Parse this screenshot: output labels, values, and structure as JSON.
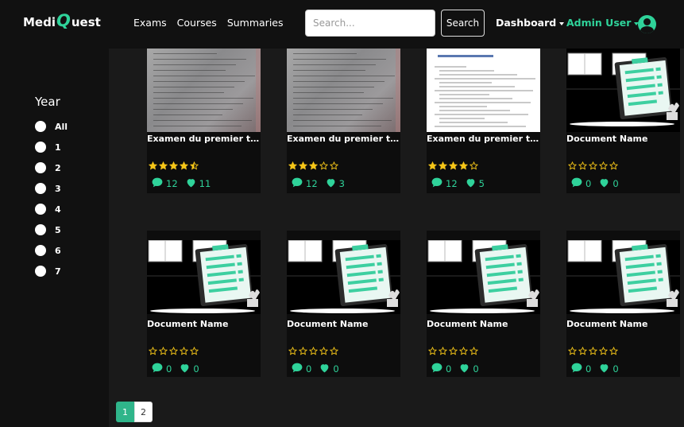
{
  "brand": {
    "part1": "Medi",
    "q": "Q",
    "part2": "uest"
  },
  "nav": {
    "exams": "Exams",
    "courses": "Courses",
    "summaries": "Summaries"
  },
  "search": {
    "placeholder": "Search...",
    "button": "Search"
  },
  "user_menu": {
    "dashboard": "Dashboard",
    "admin": "Admin User"
  },
  "colors": {
    "accent": "#2fd39a",
    "star": "#f5c518"
  },
  "filter": {
    "title": "Year",
    "options": [
      "All",
      "1",
      "2",
      "3",
      "4",
      "5",
      "6",
      "7"
    ]
  },
  "cards": [
    {
      "title": "Examen du premier tri...",
      "rating": 4.5,
      "comments": "12",
      "likes": "11",
      "thumb": "photo"
    },
    {
      "title": "Examen du premier tri...",
      "rating": 3,
      "comments": "12",
      "likes": "3",
      "thumb": "photo"
    },
    {
      "title": "Examen du premier tri...",
      "rating": 4,
      "comments": "12",
      "likes": "5",
      "thumb": "paper"
    },
    {
      "title": "Document Name",
      "rating": 0,
      "comments": "0",
      "likes": "0",
      "thumb": "illustration"
    },
    {
      "title": "Document Name",
      "rating": 0,
      "comments": "0",
      "likes": "0",
      "thumb": "illustration"
    },
    {
      "title": "Document Name",
      "rating": 0,
      "comments": "0",
      "likes": "0",
      "thumb": "illustration"
    },
    {
      "title": "Document Name",
      "rating": 0,
      "comments": "0",
      "likes": "0",
      "thumb": "illustration"
    },
    {
      "title": "Document Name",
      "rating": 0,
      "comments": "0",
      "likes": "0",
      "thumb": "illustration"
    }
  ],
  "pagination": {
    "pages": [
      "1",
      "2"
    ],
    "active": "1"
  }
}
